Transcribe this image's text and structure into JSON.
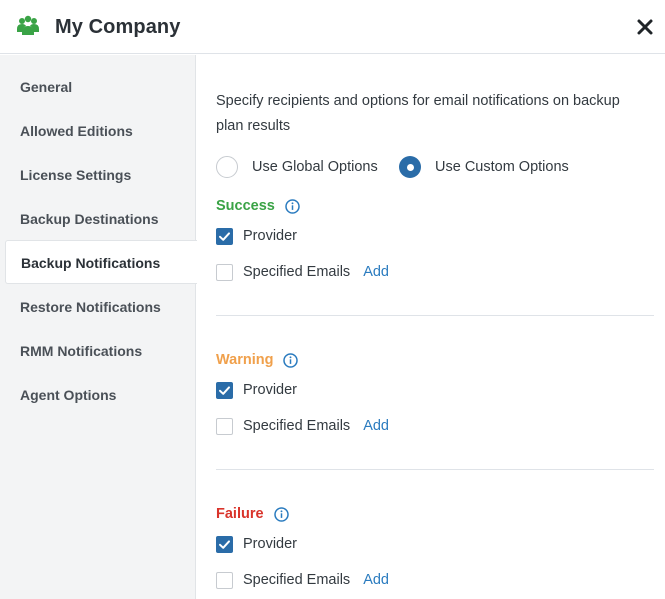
{
  "header": {
    "title": "My Company",
    "logo_icon": "group-icon",
    "logo_color": "#3aa346",
    "close_icon": "close-icon"
  },
  "sidebar": {
    "items": [
      {
        "label": "General",
        "active": false
      },
      {
        "label": "Allowed Editions",
        "active": false
      },
      {
        "label": "License Settings",
        "active": false
      },
      {
        "label": "Backup Destinations",
        "active": false
      },
      {
        "label": "Backup Notifications",
        "active": true
      },
      {
        "label": "Restore Notifications",
        "active": false
      },
      {
        "label": "RMM Notifications",
        "active": false
      },
      {
        "label": "Agent Options",
        "active": false
      }
    ]
  },
  "main": {
    "description": "Specify recipients and options for email notifications on backup plan results",
    "options": {
      "global_label": "Use Global Options",
      "custom_label": "Use Custom Options",
      "selected": "custom"
    },
    "sections": [
      {
        "title": "Success",
        "color": "#3aa346",
        "provider_label": "Provider",
        "provider_checked": true,
        "emails_label": "Specified Emails",
        "emails_checked": false,
        "add_label": "Add"
      },
      {
        "title": "Warning",
        "color": "#f0a04b",
        "provider_label": "Provider",
        "provider_checked": true,
        "emails_label": "Specified Emails",
        "emails_checked": false,
        "add_label": "Add"
      },
      {
        "title": "Failure",
        "color": "#d9342b",
        "provider_label": "Provider",
        "provider_checked": true,
        "emails_label": "Specified Emails",
        "emails_checked": false,
        "add_label": "Add"
      }
    ]
  },
  "colors": {
    "accent": "#2a6ca8",
    "link": "#2a7bbf",
    "info_icon": "#2a7bbf"
  }
}
